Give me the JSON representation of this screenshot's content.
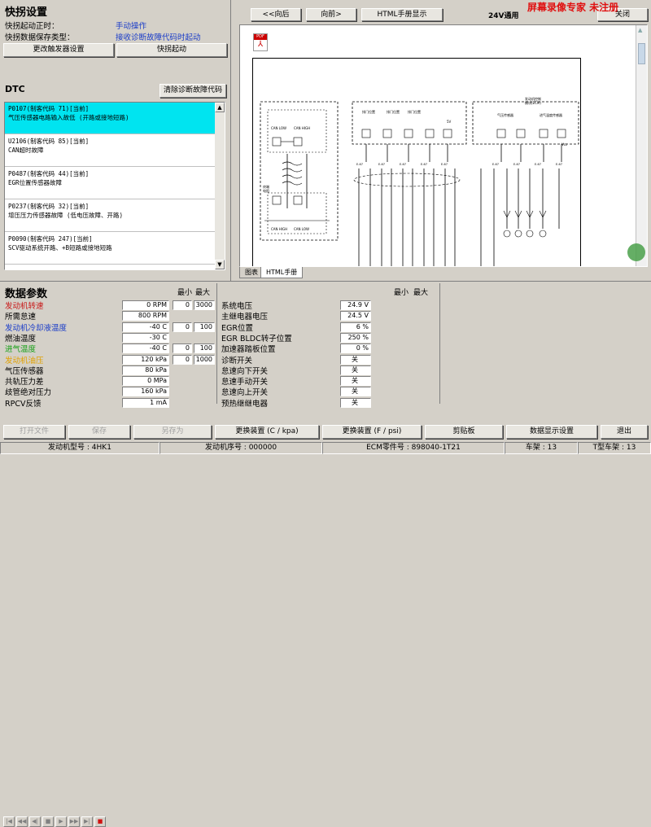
{
  "snapshot": {
    "title": "快拐设置",
    "start_label": "快拐起动正时：",
    "start_value": "手动操作",
    "save_label": "快拐数据保存类型：",
    "save_value": "接收诊断故障代码时起动",
    "change_trigger_button": "更改触发器设置",
    "start_button": "快拐起动"
  },
  "dtc": {
    "title": "DTC",
    "clear_button": "清除诊断故障代码",
    "items": [
      {
        "line1": "P0107(制客代码 71)[当前]",
        "line2": "气压传感器电路输入故低 (开路或接地短路)"
      },
      {
        "line1": "U2106(制客代码 85)[当前]",
        "line2": "CAN超时故障"
      },
      {
        "line1": "P0487(制客代码 44)[当前]",
        "line2": "EGR位置传感器故障"
      },
      {
        "line1": "P0237(制客代码 32)[当前]",
        "line2": "增压压力传感器故障 (低电压故障、开路)"
      },
      {
        "line1": "P0090(制客代码 247)[当前]",
        "line2": "SCV驱动系统开路、+B短路或接地短路"
      }
    ]
  },
  "viewer": {
    "back_button": "<<向后",
    "forward_button": "向前>",
    "html_button": "HTML手册显示",
    "voltage_label": "24V通用",
    "close_button": "关闭",
    "watermark": "屏幕录像专家 未注册",
    "tabs": [
      "图表",
      "HTML手册"
    ]
  },
  "diagram_labels": {
    "can_low": "CAN LOW",
    "can_high": "CAN HIGH",
    "resistor_label": "终端\n电阻",
    "ecu_label": "发动机控制\n模块(ECM)",
    "sensor1": "排门位置\n传感器\n1信号",
    "sensor2": "排门位置\n传感器\n2信号",
    "sensor3": "排门位置\n传感器\n3信号",
    "v5": "5V",
    "pressure": "气压传感器\n信号",
    "intake": "进气温度传感器\n信号",
    "vcc": "Vcc"
  },
  "params": {
    "title": "数据参数",
    "min_label": "最小",
    "max_label": "最大",
    "left": [
      {
        "name": "发动机转速",
        "value": "0 RPM",
        "min": "0",
        "max": "3000",
        "color": "#c81818"
      },
      {
        "name": "所需怠速",
        "value": "800 RPM",
        "min": "",
        "max": "",
        "color": "#000000"
      },
      {
        "name": "发动机冷却液温度",
        "value": "-40 C",
        "min": "0",
        "max": "100",
        "color": "#1a3cc8"
      },
      {
        "name": "燃油温度",
        "value": "-30 C",
        "min": "",
        "max": "",
        "color": "#000000"
      },
      {
        "name": "进气温度",
        "value": "-40 C",
        "min": "0",
        "max": "100",
        "color": "#18a018"
      },
      {
        "name": "发动机油压",
        "value": "120 kPa",
        "min": "0",
        "max": "1000",
        "color": "#e0a000"
      },
      {
        "name": "气压传感器",
        "value": "80 kPa",
        "min": "",
        "max": "",
        "color": "#000000"
      },
      {
        "name": "共轨压力差",
        "value": "0 MPa",
        "min": "",
        "max": "",
        "color": "#000000"
      },
      {
        "name": "歧管绝对压力",
        "value": "160 kPa",
        "min": "",
        "max": "",
        "color": "#000000"
      },
      {
        "name": "RPCV反馈",
        "value": "1 mA",
        "min": "",
        "max": "",
        "color": "#000000"
      }
    ],
    "right": [
      {
        "name": "系统电压",
        "value": "24.9 V"
      },
      {
        "name": "主继电器电压",
        "value": "24.5 V"
      },
      {
        "name": "EGR位置",
        "value": "6 %"
      },
      {
        "name": "EGR BLDC转子位置",
        "value": "250 %"
      },
      {
        "name": "加速器踏板位置",
        "value": "0 %"
      },
      {
        "name": "诊断开关",
        "value": "关"
      },
      {
        "name": "怠速向下开关",
        "value": "关"
      },
      {
        "name": "怠速手动开关",
        "value": "关"
      },
      {
        "name": "怠速向上开关",
        "value": "关"
      },
      {
        "name": "预热继继电器",
        "value": "关"
      }
    ]
  },
  "toolbar": {
    "open_file": "打开文件",
    "save": "保存",
    "save_as": "另存为",
    "switch_c_kpa": "更换装置 (C / kpa)",
    "switch_f_psi": "更换装置 (F / psi)",
    "clipboard": "剪贴板",
    "data_display": "数据显示设置",
    "exit": "退出"
  },
  "status": {
    "engine_model": "发动机型号 : 4HK1",
    "engine_serial": "发动机序号 : 000000",
    "ecm_part": "ECM零件号 : 898040-1T21",
    "frame": "车架 : 13",
    "frame_type": "T型车架 : 13"
  }
}
